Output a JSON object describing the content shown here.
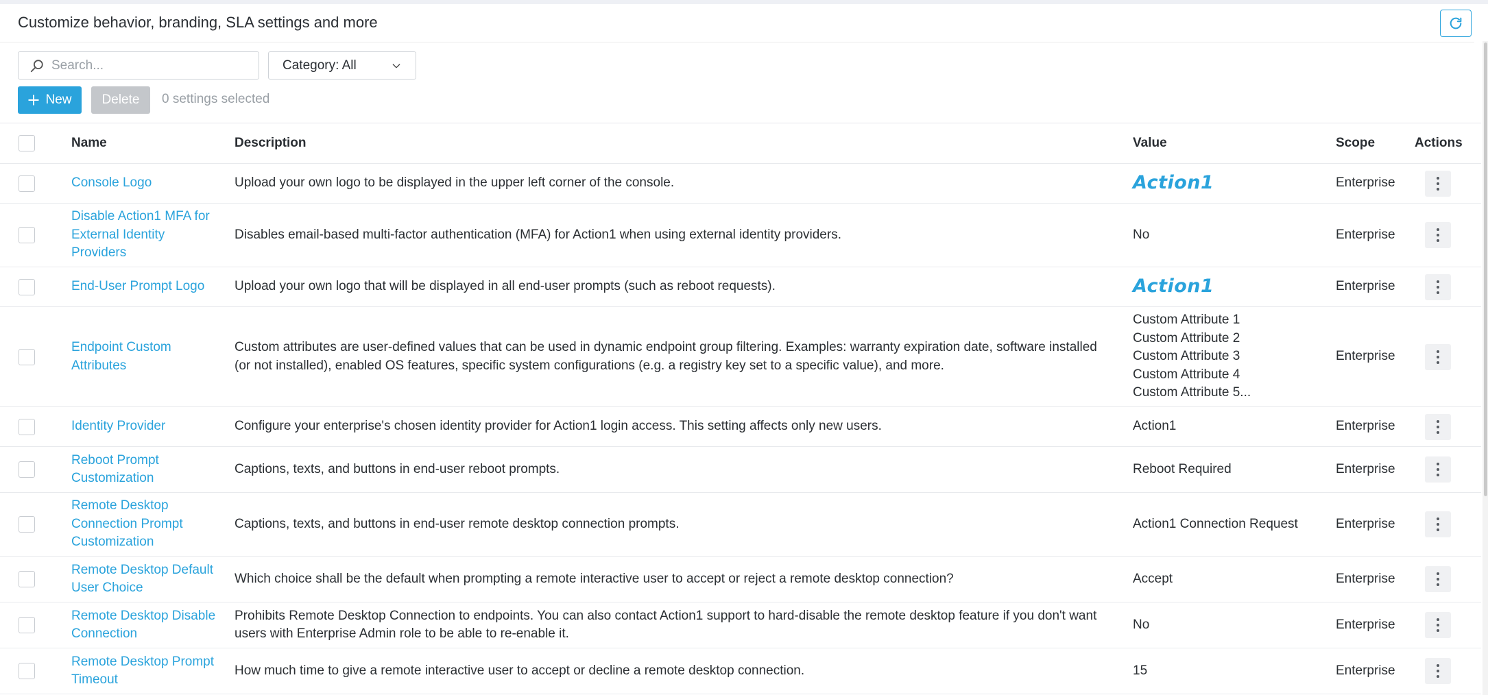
{
  "header": {
    "title": "Customize behavior, branding, SLA settings and more"
  },
  "toolbar": {
    "search_placeholder": "Search...",
    "category_label": "Category: All",
    "new_label": "New",
    "delete_label": "Delete",
    "selected_count": "0 settings selected"
  },
  "table": {
    "columns": {
      "name": "Name",
      "description": "Description",
      "value": "Value",
      "scope": "Scope",
      "actions": "Actions"
    },
    "rows": [
      {
        "name": "Console Logo",
        "description": "Upload your own logo to be displayed in the upper left corner of the console.",
        "value": "Action1",
        "scope": "Enterprise"
      },
      {
        "name": "Disable Action1 MFA for External Identity Providers",
        "description": "Disables email-based multi-factor authentication (MFA) for Action1 when using external identity providers.",
        "value": "No",
        "scope": "Enterprise"
      },
      {
        "name": "End-User Prompt Logo",
        "description": "Upload your own logo that will be displayed in all end-user prompts (such as reboot requests).",
        "value": "Action1",
        "scope": "Enterprise"
      },
      {
        "name": "Endpoint Custom Attributes",
        "description": "Custom attributes are user-defined values that can be used in dynamic endpoint group filtering. Examples: warranty expiration date, software installed (or not installed), enabled OS features, specific system configurations (e.g. a registry key set to a specific value), and more.",
        "value_list": [
          "Custom Attribute 1",
          "Custom Attribute 2",
          "Custom Attribute 3",
          "Custom Attribute 4",
          "Custom Attribute 5..."
        ],
        "scope": "Enterprise"
      },
      {
        "name": "Identity Provider",
        "description": "Configure your enterprise's chosen identity provider for Action1 login access. This setting affects only new users.",
        "value": "Action1",
        "scope": "Enterprise"
      },
      {
        "name": "Reboot Prompt Customization",
        "description": "Captions, texts, and buttons in end-user reboot prompts.",
        "value": "Reboot Required",
        "scope": "Enterprise"
      },
      {
        "name": "Remote Desktop Connection Prompt Customization",
        "description": "Captions, texts, and buttons in end-user remote desktop connection prompts.",
        "value": "Action1 Connection Request",
        "scope": "Enterprise"
      },
      {
        "name": "Remote Desktop Default User Choice",
        "description": "Which choice shall be the default when prompting a remote interactive user to accept or reject a remote desktop connection?",
        "value": "Accept",
        "scope": "Enterprise"
      },
      {
        "name": "Remote Desktop Disable Connection",
        "description": "Prohibits Remote Desktop Connection to endpoints. You can also contact Action1 support to hard-disable the remote desktop feature if you don't want users with Enterprise Admin role to be able to re-enable it.",
        "value": "No",
        "scope": "Enterprise"
      },
      {
        "name": "Remote Desktop Prompt Timeout",
        "description": "How much time to give a remote interactive user to accept or decline a remote desktop connection.",
        "value": "15",
        "scope": "Enterprise"
      }
    ]
  },
  "colors": {
    "accent": "#2aa3dc",
    "link": "#2aa3dc",
    "disabled_button": "#c4c7cb"
  },
  "icons": {
    "refresh": "refresh-icon",
    "search": "search-icon",
    "dropdown": "chevron-down-icon",
    "add": "plus-icon",
    "row_actions": "more-vertical-icon"
  }
}
